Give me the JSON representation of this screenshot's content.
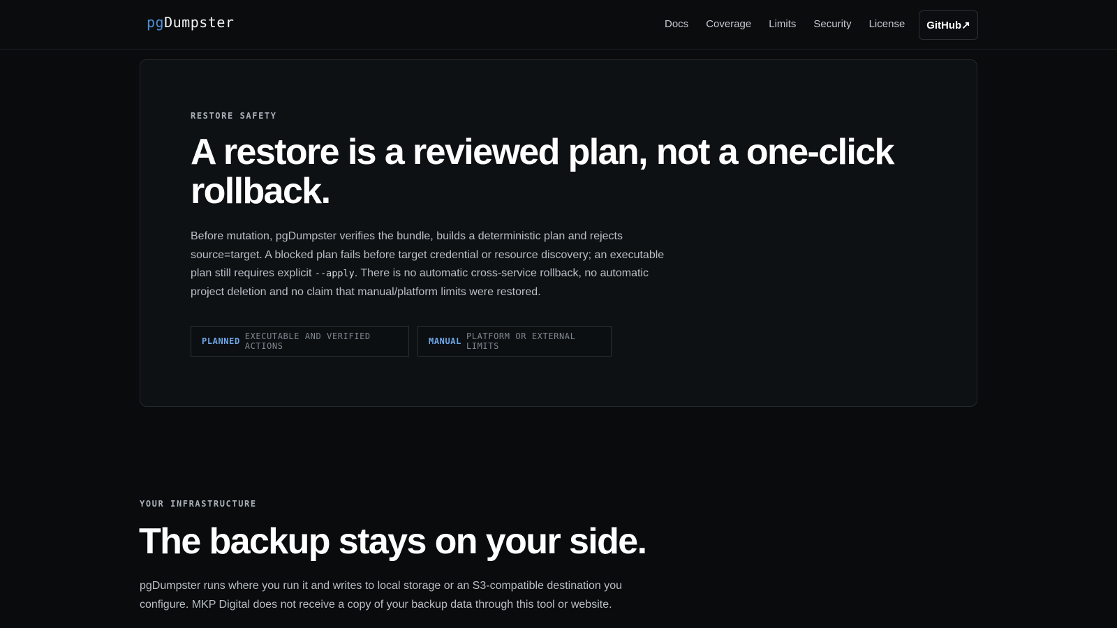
{
  "header": {
    "logo_prefix": "pg",
    "logo_rest": "Dumpster",
    "nav": [
      "Docs",
      "Coverage",
      "Limits",
      "Security",
      "License"
    ],
    "github_label": "GitHub↗"
  },
  "restore": {
    "eyebrow": "RESTORE SAFETY",
    "title": "A restore is a reviewed plan, not a one-click rollback.",
    "body_part1": "Before mutation, pgDumpster verifies the bundle, builds a deterministic plan and rejects source=target. A blocked plan fails before target credential or resource discovery; an executable plan still requires explicit ",
    "body_code": "--apply",
    "body_part2": ". There is no automatic cross-service rollback, no automatic project deletion and no claim that manual/platform limits were restored.",
    "tags": [
      {
        "key": "PLANNED",
        "text": "EXECUTABLE AND VERIFIED ACTIONS"
      },
      {
        "key": "MANUAL",
        "text": "PLATFORM OR EXTERNAL LIMITS"
      }
    ]
  },
  "infrastructure": {
    "eyebrow": "YOUR INFRASTRUCTURE",
    "title": "The backup stays on your side.",
    "body": "pgDumpster runs where you run it and writes to local storage or an S3-compatible destination you configure. MKP Digital does not receive a copy of your backup data through this tool or website."
  }
}
